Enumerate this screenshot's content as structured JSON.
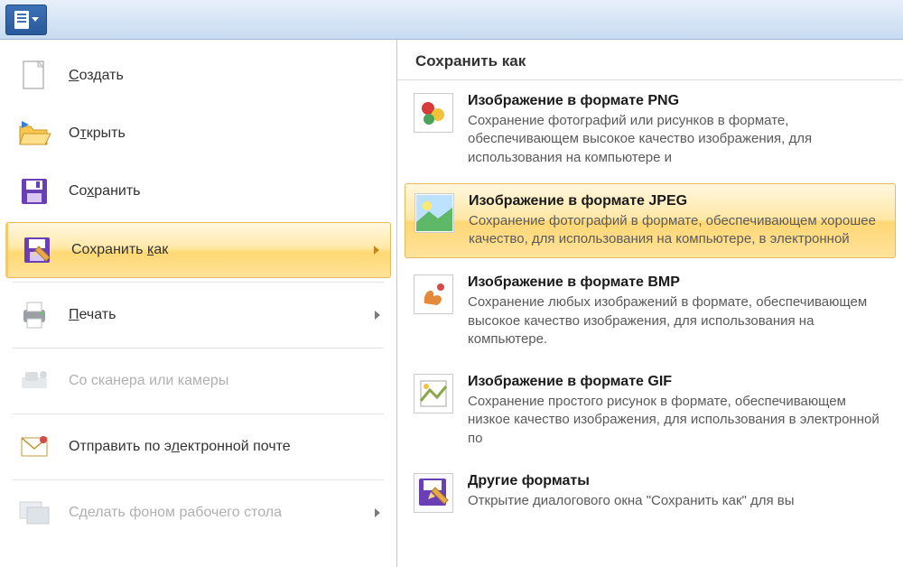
{
  "submenu_title": "Сохранить как",
  "left_menu": [
    {
      "key": "new",
      "label": "Создать",
      "ul_at": 0,
      "icon": "new",
      "disabled": false,
      "arrow": false
    },
    {
      "key": "open",
      "label": "Открыть",
      "ul_at": 1,
      "icon": "open",
      "disabled": false,
      "arrow": false
    },
    {
      "key": "save",
      "label": "Сохранить",
      "ul_at": 2,
      "icon": "save",
      "disabled": false,
      "arrow": false
    },
    {
      "key": "saveas",
      "label": "Сохранить как",
      "ul_at": 10,
      "icon": "saveas",
      "disabled": false,
      "arrow": true,
      "active": true
    },
    {
      "key": "print",
      "label": "Печать",
      "ul_at": 0,
      "icon": "print",
      "disabled": false,
      "arrow": true
    },
    {
      "key": "scanner",
      "label": "Со сканера или камеры",
      "ul_at": -1,
      "icon": "scanner",
      "disabled": true,
      "arrow": false
    },
    {
      "key": "email",
      "label": "Отправить по электронной почте",
      "ul_at": 14,
      "icon": "email",
      "disabled": false,
      "arrow": false
    },
    {
      "key": "wallpaper",
      "label": "Сделать фоном рабочего стола",
      "ul_at": -1,
      "icon": "wall",
      "disabled": true,
      "arrow": true
    }
  ],
  "right_options": [
    {
      "key": "png",
      "title": "Изображение в формате PNG",
      "desc": "Сохранение фотографий или рисунков в формате, обеспечивающем высокое качество изображения, для использования на компьютере и",
      "icon": "png",
      "highlight": false
    },
    {
      "key": "jpeg",
      "title": "Изображение в формате JPEG",
      "desc": "Сохранение фотографий в формате, обеспечивающем хорошее качество, для использования на компьютере, в электронной",
      "icon": "jpeg",
      "highlight": true
    },
    {
      "key": "bmp",
      "title": "Изображение в формате BMP",
      "desc": "Сохранение любых изображений в формате, обеспечивающем высокое качество изображения, для использования на компьютере.",
      "icon": "bmp",
      "highlight": false
    },
    {
      "key": "gif",
      "title": "Изображение в формате GIF",
      "desc": "Сохранение простого рисунок в формате, обеспечивающем низкое качество изображения, для использования в электронной по",
      "icon": "gif",
      "highlight": false
    },
    {
      "key": "other",
      "title": "Другие форматы",
      "desc": "Открытие диалогового окна \"Сохранить как\" для вы",
      "icon": "other",
      "highlight": false
    }
  ]
}
